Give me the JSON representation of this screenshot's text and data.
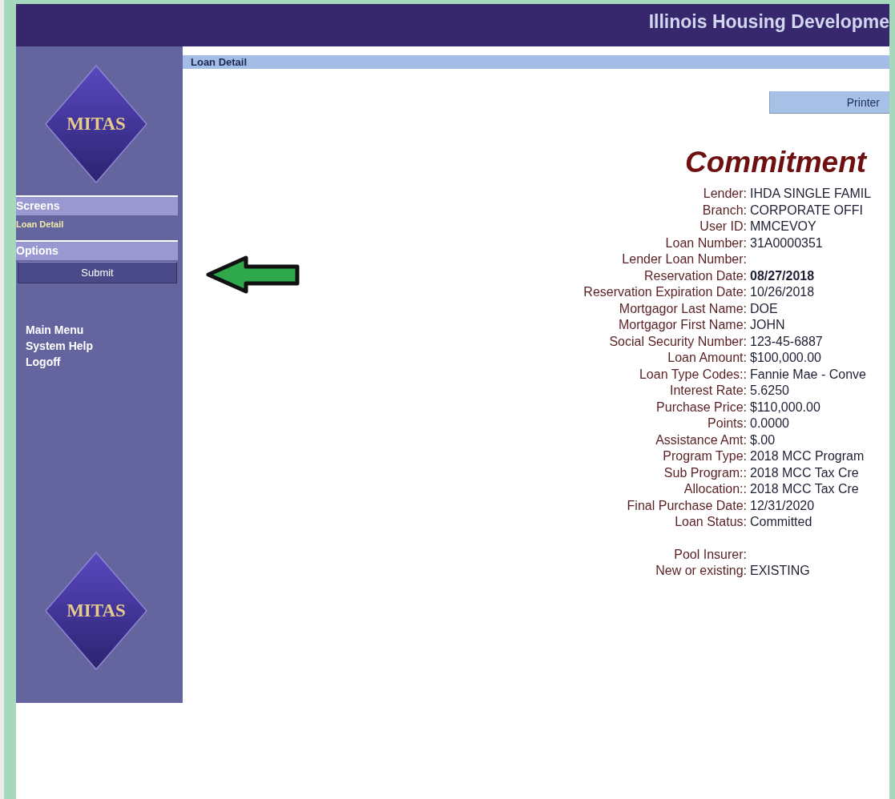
{
  "header": {
    "title": "Illinois Housing Developme"
  },
  "sidebar": {
    "logo_top": "MITAS",
    "logo_bottom": "MITAS",
    "sections": [
      {
        "kind": "links",
        "title": "Screens",
        "items": [
          {
            "label": "Loan Detail",
            "selected": true
          }
        ]
      },
      {
        "kind": "buttons",
        "title": "Options",
        "items": [
          {
            "label": "Submit",
            "selected": false
          }
        ]
      }
    ],
    "links": [
      "Main Menu",
      "System Help",
      "Logoff"
    ]
  },
  "breadcrumb": "Loan Detail",
  "printer_button": "Printer",
  "heading": "Commitment",
  "fields": [
    {
      "kind": "field",
      "label": "Lender:",
      "value": "IHDA SINGLE FAMIL",
      "bold": false
    },
    {
      "kind": "field",
      "label": "Branch:",
      "value": "CORPORATE OFFI",
      "bold": false
    },
    {
      "kind": "field",
      "label": "User ID:",
      "value": "MMCEVOY",
      "bold": false
    },
    {
      "kind": "field",
      "label": "Loan Number:",
      "value": "31A0000351",
      "bold": false
    },
    {
      "kind": "field",
      "label": "Lender Loan Number:"
    },
    {
      "kind": "field",
      "label": "Reservation Date:",
      "value": "08/27/2018",
      "bold": true
    },
    {
      "kind": "field",
      "label": "Reservation Expiration Date:",
      "value": "10/26/2018",
      "bold": false
    },
    {
      "kind": "field",
      "label": "Mortgagor Last Name:",
      "value": "DOE",
      "bold": false
    },
    {
      "kind": "field",
      "label": "Mortgagor First Name:",
      "value": "JOHN",
      "bold": false
    },
    {
      "kind": "field",
      "label": "Social Security Number:",
      "value": "123-45-6887",
      "bold": false
    },
    {
      "kind": "field",
      "label": "Loan Amount:",
      "value": "$100,000.00",
      "bold": false
    },
    {
      "kind": "field",
      "label": "Loan Type Codes::",
      "value": "Fannie Mae - Conve",
      "bold": false
    },
    {
      "kind": "field",
      "label": "Interest Rate:",
      "value": "5.6250",
      "bold": false
    },
    {
      "kind": "field",
      "label": "Purchase Price:",
      "value": "$110,000.00",
      "bold": false
    },
    {
      "kind": "field",
      "label": "Points:",
      "value": "0.0000",
      "bold": false
    },
    {
      "kind": "field",
      "label": "Assistance Amt:",
      "value": "$.00",
      "bold": false
    },
    {
      "kind": "field",
      "label": "Program Type:",
      "value": "2018 MCC Program",
      "bold": false
    },
    {
      "kind": "field",
      "label": "Sub Program::",
      "value": "2018 MCC Tax Cre",
      "bold": false
    },
    {
      "kind": "field",
      "label": "Allocation::",
      "value": "2018 MCC Tax Cre",
      "bold": false
    },
    {
      "kind": "field",
      "label": "Final Purchase Date:",
      "value": "12/31/2020",
      "bold": false
    },
    {
      "kind": "field",
      "label": "Loan Status:",
      "value": "Committed",
      "bold": false
    },
    {
      "kind": "blank"
    },
    {
      "kind": "field",
      "label": "Pool Insurer:"
    },
    {
      "kind": "field",
      "label": "New or existing:",
      "value": "EXISTING",
      "bold": false
    }
  ]
}
